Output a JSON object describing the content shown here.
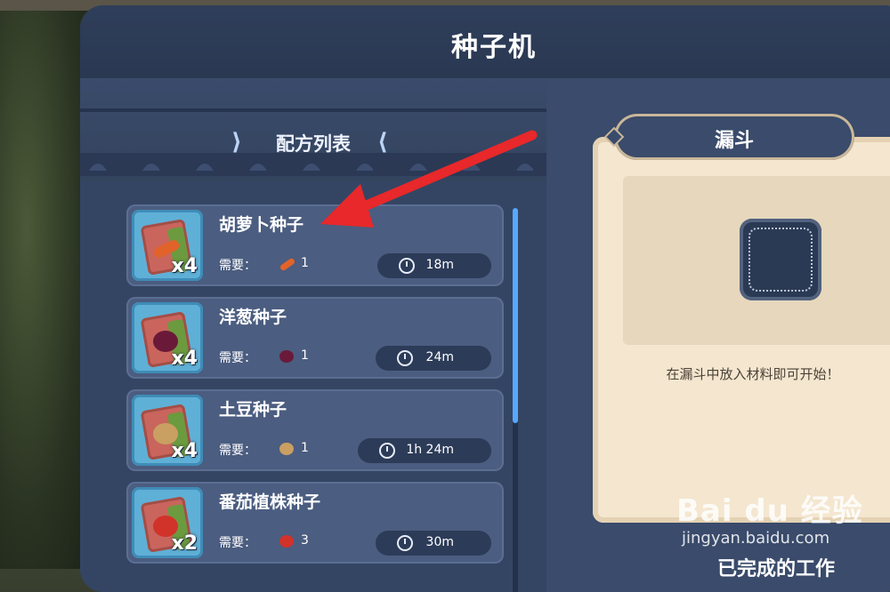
{
  "window": {
    "title": "种子机"
  },
  "recipes": {
    "title": "配方列表",
    "items": [
      {
        "name": "胡萝卜种子",
        "count": "x4",
        "need_label": "需要：",
        "need_qty": "1",
        "time": "18m",
        "veg_color": "#e2632a"
      },
      {
        "name": "洋葱种子",
        "count": "x4",
        "need_label": "需要：",
        "need_qty": "1",
        "time": "24m",
        "veg_color": "#6a1a38"
      },
      {
        "name": "土豆种子",
        "count": "x4",
        "need_label": "需要：",
        "need_qty": "1",
        "time": "1h 24m",
        "veg_color": "#c9a061"
      },
      {
        "name": "番茄植株种子",
        "count": "x2",
        "need_label": "需要：",
        "need_qty": "3",
        "time": "30m",
        "veg_color": "#d1322a"
      }
    ]
  },
  "funnel": {
    "label": "漏斗",
    "hint": "在漏斗中放入材料即可开始！"
  },
  "completed": {
    "title": "已完成的工作"
  },
  "watermark": {
    "logo": "Bai du 经验",
    "sub": "jingyan.baidu.com"
  },
  "colors": {
    "accent": "#58a8ff",
    "arrow": "#e8282a",
    "parchment": "#f4e6cf"
  }
}
